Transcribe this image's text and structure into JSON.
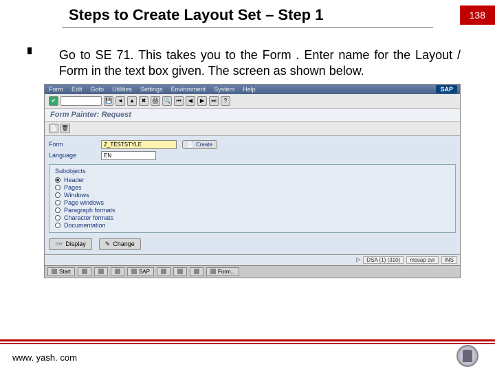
{
  "header": {
    "title": "Steps to Create Layout Set – Step 1",
    "page_number": "138"
  },
  "body_text": "Go to SE 71. This takes you to the Form . Enter name for the Layout / Form in the text box given. The screen as shown below.",
  "sap": {
    "menu": [
      "Form",
      "Edit",
      "Goto",
      "Utilities",
      "Settings",
      "Environment",
      "System",
      "Help"
    ],
    "logo": "SAP",
    "subtitle": "Form Painter: Request",
    "form_label": "Form",
    "form_value": "Z_TESTSTYLE",
    "create_btn": "Create",
    "lang_label": "Language",
    "lang_value": "EN",
    "group_title": "Subobjects",
    "radios": [
      "Header",
      "Pages",
      "Windows",
      "Page windows",
      "Paragraph formats",
      "Character formats",
      "Documentation"
    ],
    "display_btn": "Display",
    "change_btn": "Change",
    "status_items": [
      "DSA (1) (310)",
      "mssap svr",
      "INS"
    ]
  },
  "taskbar": [
    "Start",
    "",
    "",
    "",
    "SAP",
    "",
    "",
    "",
    "Form..."
  ],
  "footer": {
    "url": "www. yash. com"
  }
}
